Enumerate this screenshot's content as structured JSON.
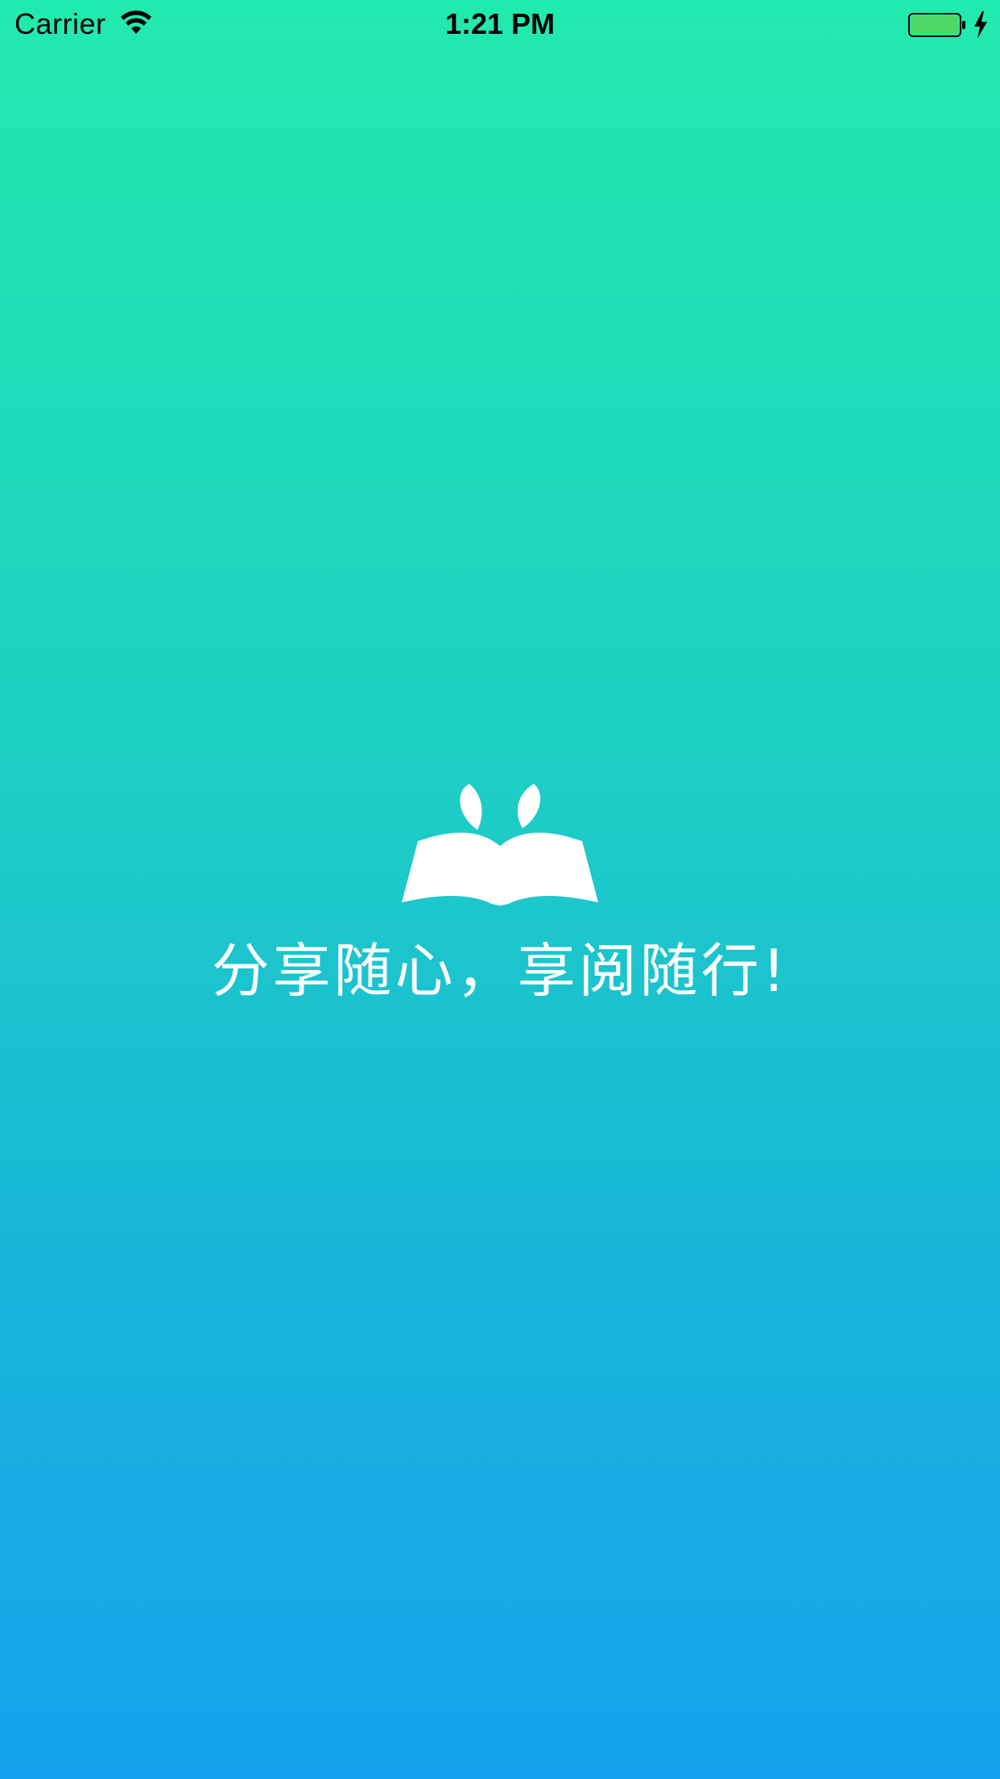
{
  "status_bar": {
    "carrier": "Carrier",
    "time": "1:21 PM",
    "icons": [
      "wifi-icon",
      "battery-icon",
      "charging-bolt-icon"
    ],
    "battery_color": "#4CD964"
  },
  "splash": {
    "logo_icon": "book-sprout-logo-icon",
    "slogan": "分享随心，享阅随行!"
  },
  "colors": {
    "gradient_top": "#21EAAE",
    "gradient_bottom": "#14A2EE",
    "foreground": "#FFFFFF"
  }
}
